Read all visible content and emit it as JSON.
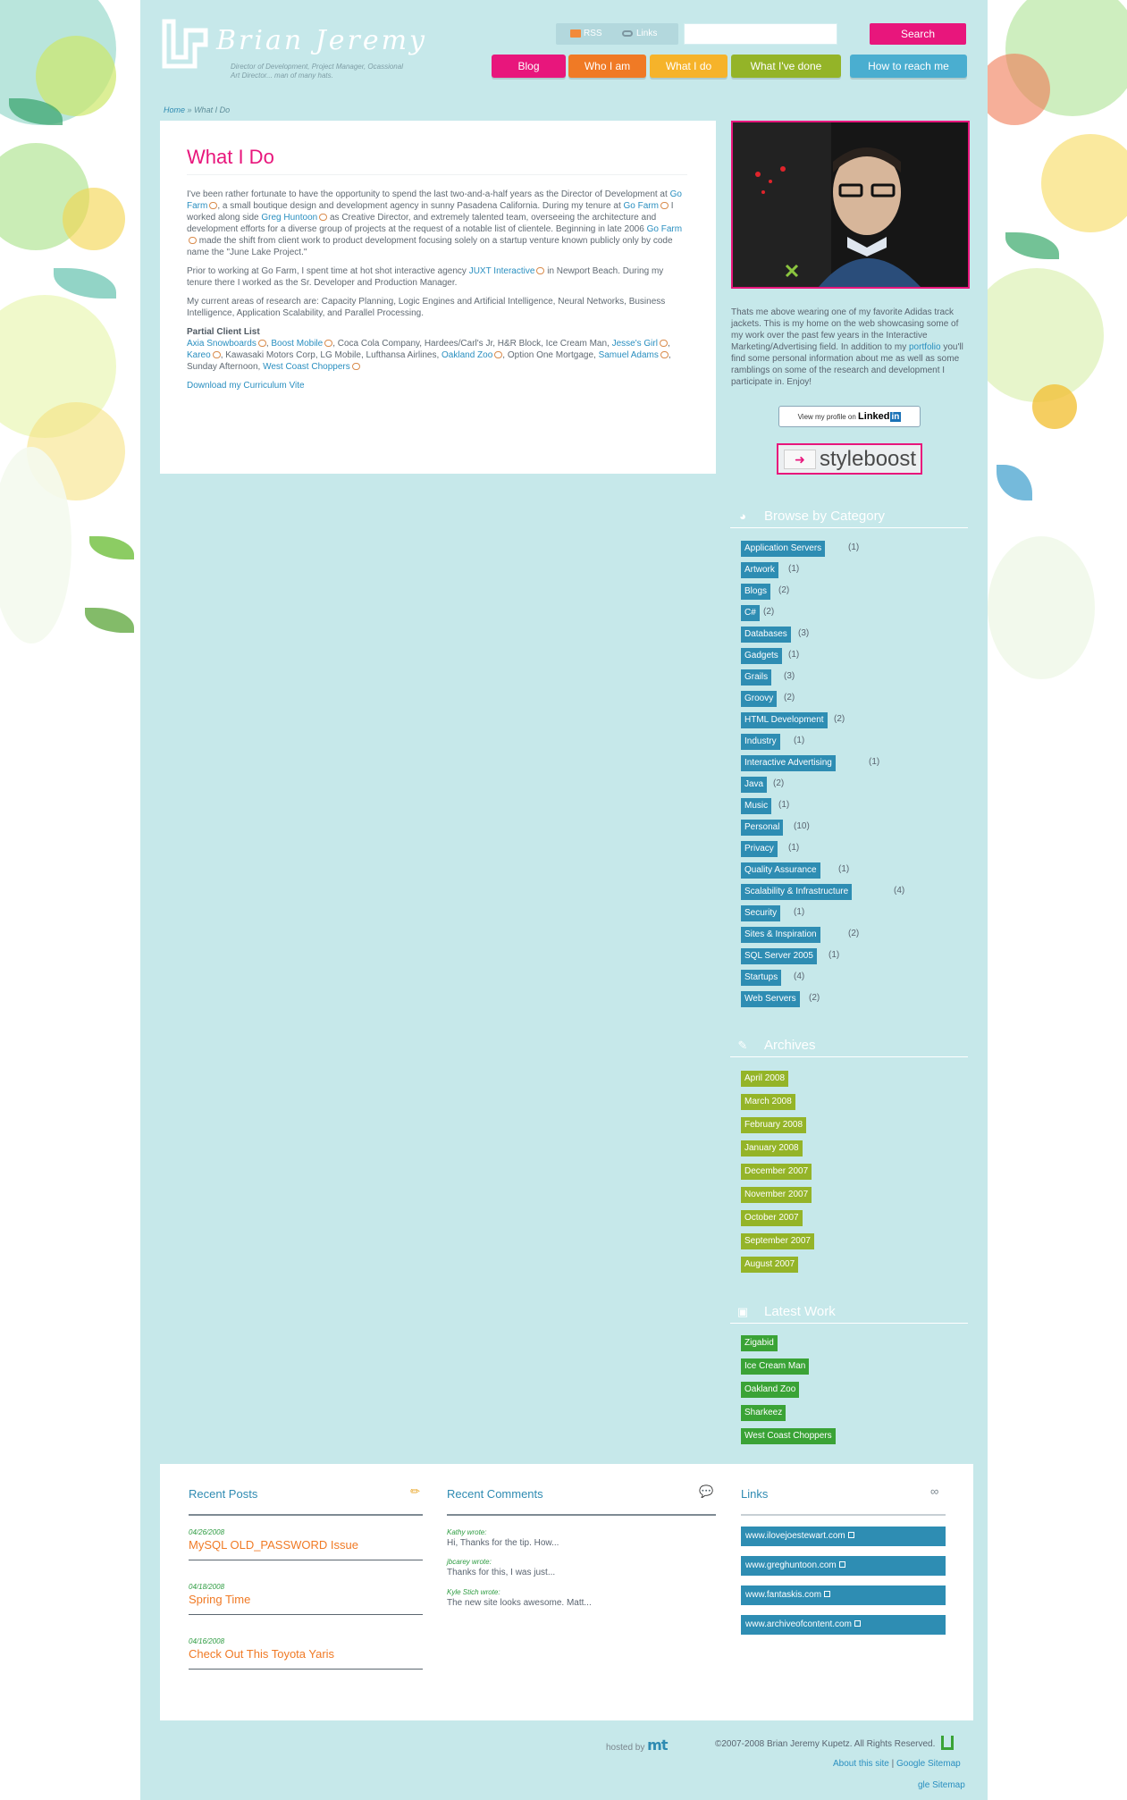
{
  "site": {
    "logo_name": "Brian Jeremy",
    "tagline": "Director of Development, Project Manager, Ocassional Art Director... man of many hats."
  },
  "header": {
    "rss_label": "RSS",
    "links_label": "Links",
    "search_placeholder": "",
    "search_button": "Search"
  },
  "nav": [
    {
      "label": "Blog",
      "color": "#e8167c"
    },
    {
      "label": "Who I am",
      "color": "#f07a25"
    },
    {
      "label": "What I do",
      "color": "#f6b32a"
    },
    {
      "label": "What I've done",
      "color": "#94b428"
    },
    {
      "label": "How to reach me",
      "color": "#4aaed0"
    }
  ],
  "breadcrumb": {
    "home": "Home",
    "sep": "»",
    "current": "What I Do"
  },
  "content": {
    "title": "What I Do",
    "p1": {
      "t1": "I've been rather fortunate to have the opportunity to spend the last two-and-a-half years as the Director of Development at ",
      "l1": "Go Farm",
      "t2": ", a small boutique design and development agency in sunny Pasadena California. During my tenure at ",
      "l2": "Go Farm",
      "t3": " I worked along side ",
      "l3": "Greg Huntoon",
      "t4": " as Creative Director, and extremely talented team, overseeing the architecture and development efforts for a diverse group of projects at the request of a notable list of clientele. Beginning in late 2006 ",
      "l4": "Go Farm",
      "t5": " made the shift from client work to product development focusing solely on a startup venture known publicly only by code name the \"June Lake Project.\""
    },
    "p2": {
      "t1": "Prior to working at Go Farm, I spent time at hot shot interactive agency ",
      "l1": "JUXT Interactive",
      "t2": " in Newport Beach. During my tenure there I worked as the Sr. Developer and Production Manager."
    },
    "p3": "My current areas of research are: Capacity Planning, Logic Engines and Artificial Intelligence, Neural Networks, Business Intelligence, Application Scalability, and Parallel Processing.",
    "clients_heading": "Partial Client List",
    "clients": {
      "c1": "Axia Snowboards",
      "c2": "Boost Mobile",
      "t1": ", Coca Cola Company, Hardees/Carl's Jr, H&R Block, Ice Cream Man, ",
      "c3": "Jesse's Girl",
      "c4": "Kareo",
      "t2": ", Kawasaki Motors Corp, LG Mobile, Lufthansa Airlines, ",
      "c5": "Oakland Zoo",
      "t3": ", Option One Mortgage, ",
      "c6": "Samuel Adams",
      "t4": ", Sunday Afternoon, ",
      "c7": "West Coast Choppers"
    },
    "download": "Download my Curriculum Vite"
  },
  "sidebar": {
    "bio": {
      "t1": "Thats me above wearing one of my favorite Adidas track jackets. This is my home on the web showcasing some of my work over the past few years in the Interactive Marketing/Advertising field. In addition to my ",
      "link": "portfolio",
      "t2": " you'll find some personal information about me as well as some ramblings on some of the research and development I participate in. Enjoy!"
    },
    "linkedin": {
      "pre": "View my profile on",
      "brand": "Linked",
      "in": "in"
    },
    "styleboost": "styleboost",
    "categories_title": "Browse by Category",
    "categories": [
      {
        "label": "Application Servers",
        "count": "(1)"
      },
      {
        "label": "Artwork",
        "count": "(1)"
      },
      {
        "label": "Blogs",
        "count": "(2)"
      },
      {
        "label": "C#",
        "count": "(2)"
      },
      {
        "label": "Databases",
        "count": "(3)"
      },
      {
        "label": "Gadgets",
        "count": "(1)"
      },
      {
        "label": "Grails",
        "count": "(3)"
      },
      {
        "label": "Groovy",
        "count": "(2)"
      },
      {
        "label": "HTML Development",
        "count": "(2)"
      },
      {
        "label": "Industry",
        "count": "(1)"
      },
      {
        "label": "Interactive Advertising",
        "count": "(1)"
      },
      {
        "label": "Java",
        "count": "(2)"
      },
      {
        "label": "Music",
        "count": "(1)"
      },
      {
        "label": "Personal",
        "count": "(10)"
      },
      {
        "label": "Privacy",
        "count": "(1)"
      },
      {
        "label": "Quality Assurance",
        "count": "(1)"
      },
      {
        "label": "Scalability & Infrastructure",
        "count": "(4)"
      },
      {
        "label": "Security",
        "count": "(1)"
      },
      {
        "label": "Sites & Inspiration",
        "count": "(2)"
      },
      {
        "label": "SQL Server 2005",
        "count": "(1)"
      },
      {
        "label": "Startups",
        "count": "(4)"
      },
      {
        "label": "Web Servers",
        "count": "(2)"
      }
    ],
    "archives_title": "Archives",
    "archives": [
      "April 2008",
      "March 2008",
      "February 2008",
      "January 2008",
      "December 2007",
      "November 2007",
      "October 2007",
      "September 2007",
      "August 2007"
    ],
    "work_title": "Latest Work",
    "work": [
      "Zigabid",
      "Ice Cream Man",
      "Oakland Zoo",
      "Sharkeez",
      "West Coast Choppers"
    ]
  },
  "bottom": {
    "recent_posts_title": "Recent Posts",
    "posts": [
      {
        "date": "04/26/2008",
        "title": "MySQL OLD_PASSWORD Issue"
      },
      {
        "date": "04/18/2008",
        "title": "Spring Time"
      },
      {
        "date": "04/16/2008",
        "title": "Check Out This Toyota Yaris"
      }
    ],
    "recent_comments_title": "Recent Comments",
    "comments": [
      {
        "name": "Kathy wrote:",
        "text": "Hi, Thanks for the tip. How..."
      },
      {
        "name": "jbcarey wrote:",
        "text": "Thanks for this, I was just..."
      },
      {
        "name": "Kyle Stich wrote:",
        "text": "The new site looks awesome. Matt..."
      }
    ],
    "links_title": "Links",
    "links": [
      "www.ilovejoestewart.com",
      "www.greghuntoon.com",
      "www.fantaskis.com",
      "www.archiveofcontent.com"
    ]
  },
  "footer": {
    "hosted_by": "hosted by",
    "host_logo": "mt",
    "copyright": "©2007-2008 Brian Jeremy Kupetz. All Rights Reserved.",
    "about": "About this site",
    "sep": "|",
    "sitemap": "Google Sitemap",
    "sitemap_fragment": "gle Sitemap"
  }
}
